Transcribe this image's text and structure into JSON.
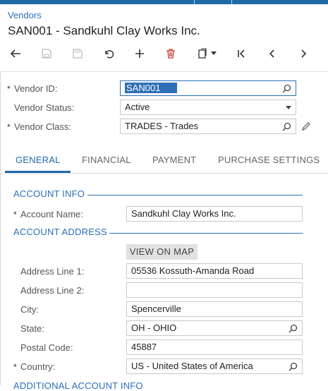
{
  "header": {
    "breadcrumb": "Vendors",
    "title": "SAN001 - Sandkuhl Clay Works Inc."
  },
  "toolbar": {
    "icons": [
      "back-icon",
      "save-close-icon",
      "save-icon",
      "undo-icon",
      "add-icon",
      "delete-icon",
      "copy-paste-icon",
      "first-record-icon",
      "previous-record-icon",
      "next-record-icon"
    ]
  },
  "vendor": {
    "id_label": "Vendor ID:",
    "id_value": "SAN001",
    "status_label": "Vendor Status:",
    "status_value": "Active",
    "class_label": "Vendor Class:",
    "class_value": "TRADES - Trades"
  },
  "tabs": [
    "GENERAL",
    "FINANCIAL",
    "PAYMENT",
    "PURCHASE SETTINGS"
  ],
  "account_info": {
    "heading": "ACCOUNT INFO",
    "name_label": "Account Name:",
    "name_value": "Sandkuhl Clay Works Inc."
  },
  "account_address": {
    "heading": "ACCOUNT ADDRESS",
    "view_map_label": "VIEW ON MAP",
    "line1_label": "Address Line 1:",
    "line1_value": "05536 Kossuth-Amanda Road",
    "line2_label": "Address Line 2:",
    "line2_value": "",
    "city_label": "City:",
    "city_value": "Spencerville",
    "state_label": "State:",
    "state_value": "OH - OHIO",
    "postal_label": "Postal Code:",
    "postal_value": "45887",
    "country_label": "Country:",
    "country_value": "US - United States of America"
  },
  "next_section": {
    "heading": "ADDITIONAL ACCOUNT INFO"
  },
  "required_marker": "*",
  "colors": {
    "accent": "#1f6aa8",
    "link": "#2a6fb7",
    "selection": "#2f6fb8"
  }
}
